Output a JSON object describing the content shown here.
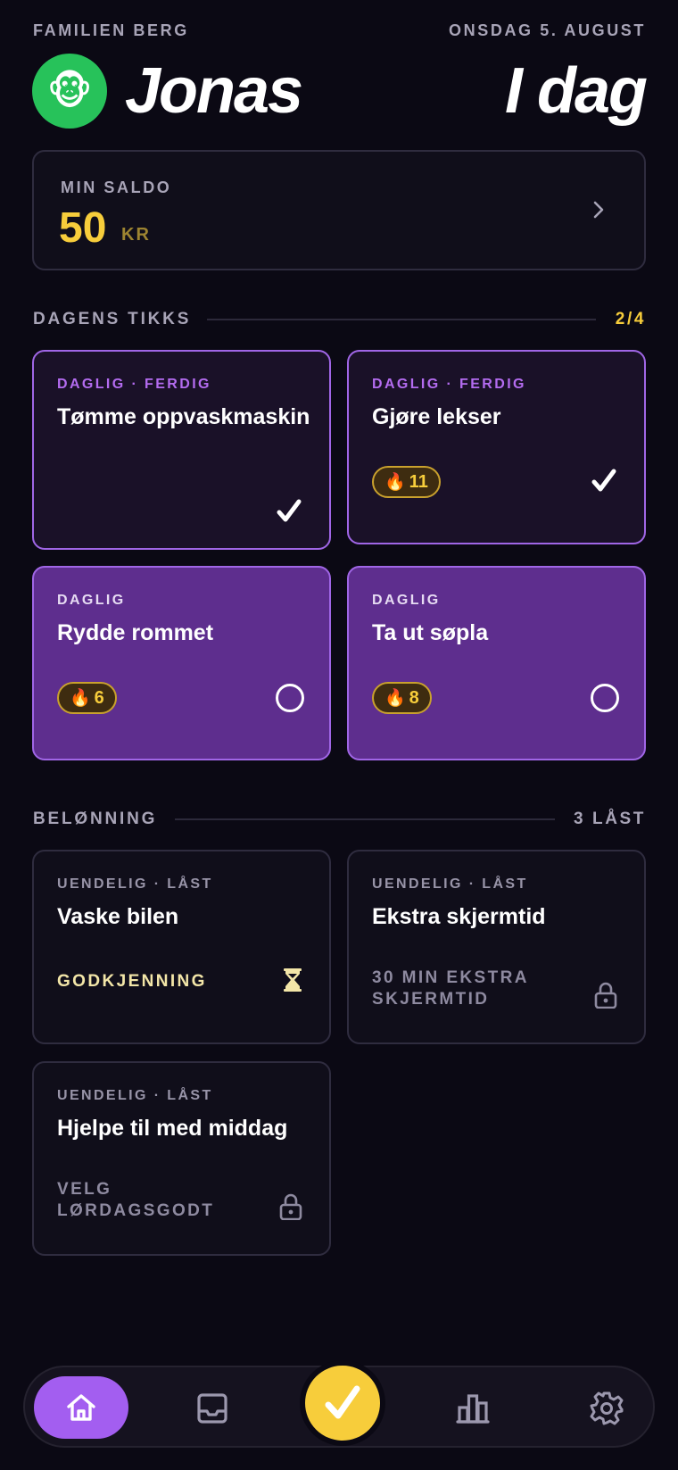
{
  "header": {
    "family": "FAMILIEN BERG",
    "date": "ONSDAG 5. AUGUST",
    "avatar_emoji": "🐵",
    "name": "Jonas",
    "today": "I dag"
  },
  "balance": {
    "label": "MIN SALDO",
    "amount": "50",
    "unit": "KR"
  },
  "tasks_section": {
    "label": "DAGENS TIKKS",
    "count": "2/4",
    "tasks": [
      {
        "tag": "DAGLIG · FERDIG",
        "title": "Tømme oppvaskmaskin",
        "status": "done",
        "streak": null
      },
      {
        "tag": "DAGLIG · FERDIG",
        "title": "Gjøre lekser",
        "status": "done",
        "streak": "11"
      },
      {
        "tag": "DAGLIG",
        "title": "Rydde rommet",
        "status": "open",
        "streak": "6"
      },
      {
        "tag": "DAGLIG",
        "title": "Ta ut søpla",
        "status": "open",
        "streak": "8"
      }
    ]
  },
  "rewards_section": {
    "label": "BELØNNING",
    "count": "3 LÅST",
    "rewards": [
      {
        "tag": "UENDELIG · LÅST",
        "title": "Vaske bilen",
        "sub": "GODKJENNING",
        "state": "pending"
      },
      {
        "tag": "UENDELIG · LÅST",
        "title": "Ekstra skjermtid",
        "sub": "30 MIN EKSTRA SKJERMTID",
        "state": "locked"
      },
      {
        "tag": "UENDELIG · LÅST",
        "title": "Hjelpe til med middag",
        "sub": "VELG LØRDAGSGODT",
        "state": "locked"
      }
    ]
  },
  "nav": {
    "items": [
      "home-icon",
      "inbox-icon",
      "check-icon",
      "stats-icon",
      "settings-icon"
    ],
    "active": "home-icon"
  },
  "colors": {
    "background": "#0b0914",
    "accent_purple": "#a35ef0",
    "accent_yellow": "#f7cd3b",
    "open_card": "#5e2e8e"
  }
}
